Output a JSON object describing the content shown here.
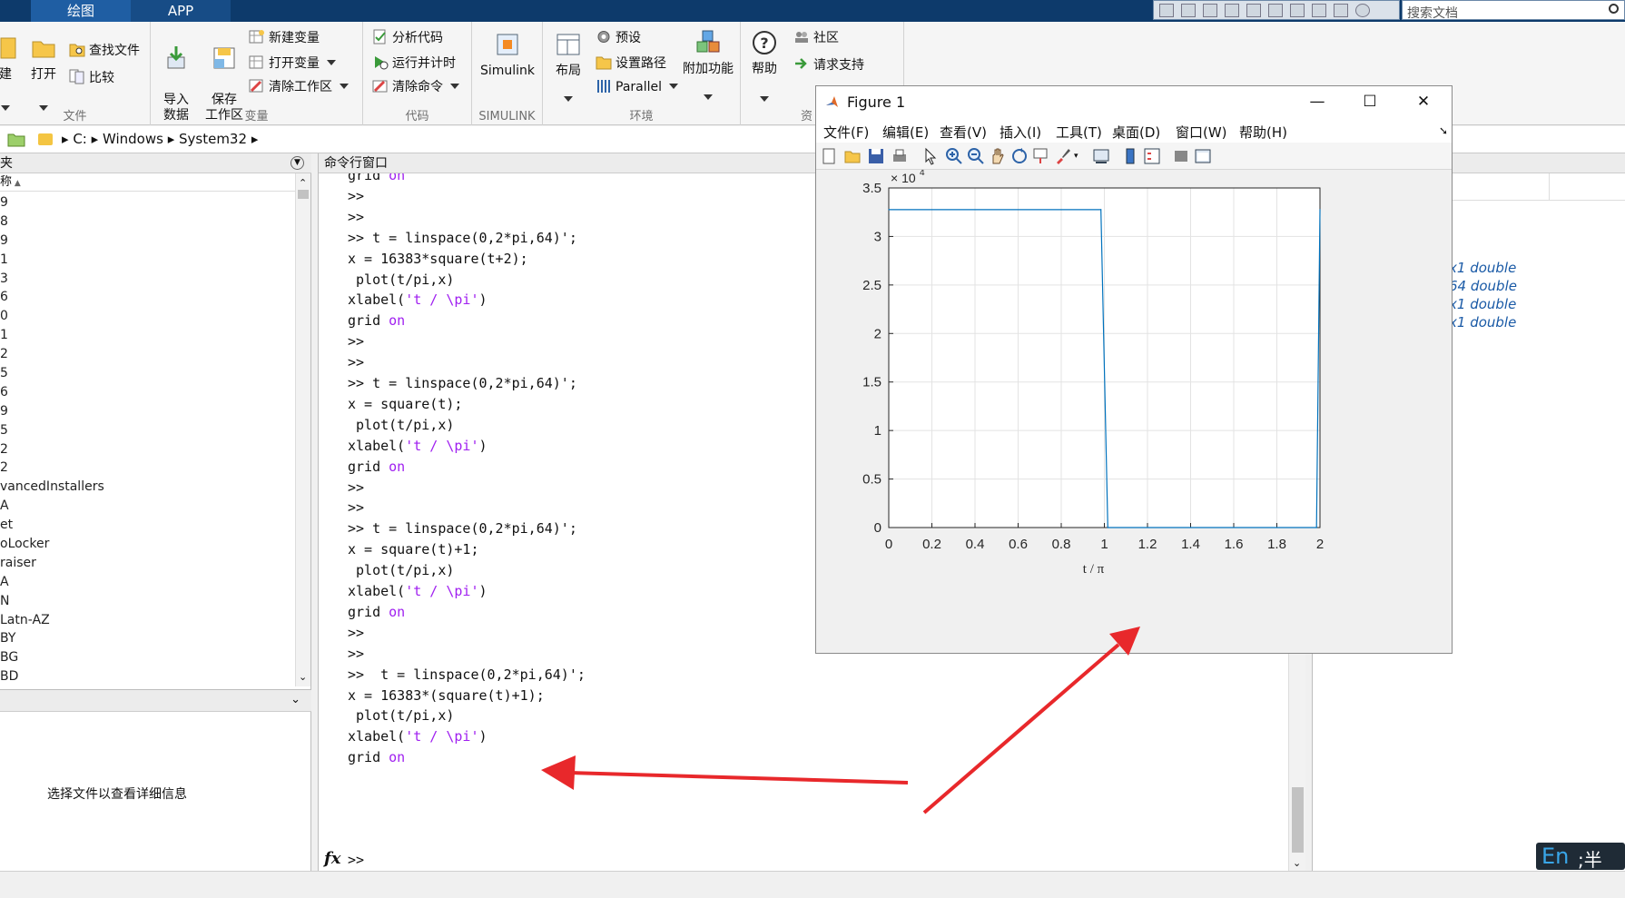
{
  "toolstrip": {
    "tabs": [
      "绘图",
      "APP"
    ],
    "search_placeholder": "搜索文档"
  },
  "ribbon": {
    "groups": {
      "file": {
        "label": "文件",
        "new_label": "建",
        "open_label": "打开",
        "find_files_label": "查找文件",
        "compare_label": "比较"
      },
      "variable": {
        "label": "变量",
        "import_label": "导入\n数据",
        "save_label": "保存\n工作区",
        "new_var_label": "新建变量",
        "open_var_label": "打开变量",
        "clear_ws_label": "清除工作区"
      },
      "code": {
        "label": "代码",
        "analyze_label": "分析代码",
        "run_time_label": "运行并计时",
        "clear_cmd_label": "清除命令"
      },
      "simulink": {
        "label": "SIMULINK",
        "simulink_label": "Simulink"
      },
      "environment": {
        "label": "环境",
        "layout_label": "布局",
        "prefs_label": "预设",
        "setpath_label": "设置路径",
        "parallel_label": "Parallel",
        "addons_label": "附加功能"
      },
      "resources": {
        "label": "资",
        "help_label": "帮助",
        "community_label": "社区",
        "support_label": "请求支持"
      }
    }
  },
  "address": {
    "path": [
      "C:",
      "Windows",
      "System32"
    ]
  },
  "file_browser": {
    "header": "夹",
    "column_name": "称",
    "items": [
      "9",
      "8",
      "9",
      "1",
      "3",
      "6",
      "0",
      "1",
      "2",
      "5",
      "6",
      "9",
      "5",
      "2",
      "2",
      "vancedInstallers",
      "A",
      "et",
      "oLocker",
      "raiser",
      "A",
      "N",
      "Latn-AZ",
      "BY",
      "BG",
      "BD"
    ],
    "details_message": "选择文件以查看详细信息"
  },
  "command_window": {
    "title": "命令行窗口",
    "lines": [
      {
        "text": "grid ",
        "kw": "on"
      },
      {
        "text": ">>",
        "kw": ""
      },
      {
        "text": ">>",
        "kw": ""
      },
      {
        "text": ">> t = linspace(0,2*pi,64)';",
        "kw": ""
      },
      {
        "text": "x = 16383*square(t+2);",
        "kw": ""
      },
      {
        "text": " plot(t/pi,x)",
        "kw": ""
      },
      {
        "text": "xlabel('t / \\pi')",
        "kw": ""
      },
      {
        "text": "grid ",
        "kw": "on"
      },
      {
        "text": ">>",
        "kw": ""
      },
      {
        "text": ">>",
        "kw": ""
      },
      {
        "text": ">> t = linspace(0,2*pi,64)';",
        "kw": ""
      },
      {
        "text": "x = square(t);",
        "kw": ""
      },
      {
        "text": " plot(t/pi,x)",
        "kw": ""
      },
      {
        "text": "xlabel('t / \\pi')",
        "kw": ""
      },
      {
        "text": "grid ",
        "kw": "on"
      },
      {
        "text": ">>",
        "kw": ""
      },
      {
        "text": ">>",
        "kw": ""
      },
      {
        "text": ">> t = linspace(0,2*pi,64)';",
        "kw": ""
      },
      {
        "text": "x = square(t)+1;",
        "kw": ""
      },
      {
        "text": " plot(t/pi,x)",
        "kw": ""
      },
      {
        "text": "xlabel('t / \\pi')",
        "kw": ""
      },
      {
        "text": "grid ",
        "kw": "on"
      },
      {
        "text": ">>",
        "kw": ""
      },
      {
        "text": ">>",
        "kw": ""
      },
      {
        "text": ">>  t = linspace(0,2*pi,64)';",
        "kw": ""
      },
      {
        "text": "x = 16383*(square(t)+1);",
        "kw": ""
      },
      {
        "text": " plot(t/pi,x)",
        "kw": ""
      },
      {
        "text": "xlabel('t / \\pi')",
        "kw": ""
      },
      {
        "text": "grid ",
        "kw": "on"
      }
    ],
    "prompt": ">>",
    "fx_label": "fx"
  },
  "workspace": {
    "values": [
      "x1 double",
      "64 double",
      "x1 double",
      "x1 double"
    ]
  },
  "ime": {
    "lang": "En",
    "rest": ";半"
  },
  "figure": {
    "title": "Figure 1",
    "menu": [
      "文件(F)",
      "编辑(E)",
      "查看(V)",
      "插入(I)",
      "工具(T)",
      "桌面(D)",
      "窗口(W)",
      "帮助(H)"
    ],
    "colors": {
      "line": "#0072bd",
      "annotation_arrow": "#e8282b"
    }
  },
  "chart_data": {
    "type": "line",
    "title": "",
    "xlabel": "t / π",
    "ylabel": "",
    "xlim": [
      0,
      2
    ],
    "ylim": [
      0,
      35000
    ],
    "grid": true,
    "exponent_label": "× 10",
    "exponent_power": "4",
    "x_ticks": [
      "0",
      "0.2",
      "0.4",
      "0.6",
      "0.8",
      "1",
      "1.2",
      "1.4",
      "1.6",
      "1.8",
      "2"
    ],
    "y_ticks": [
      "0",
      "0.5",
      "1",
      "1.5",
      "2",
      "2.5",
      "3",
      "3.5"
    ],
    "x": [
      0,
      0.984,
      1.016,
      1.984,
      2.0
    ],
    "y": [
      32766,
      32766,
      0,
      0,
      32766
    ]
  }
}
